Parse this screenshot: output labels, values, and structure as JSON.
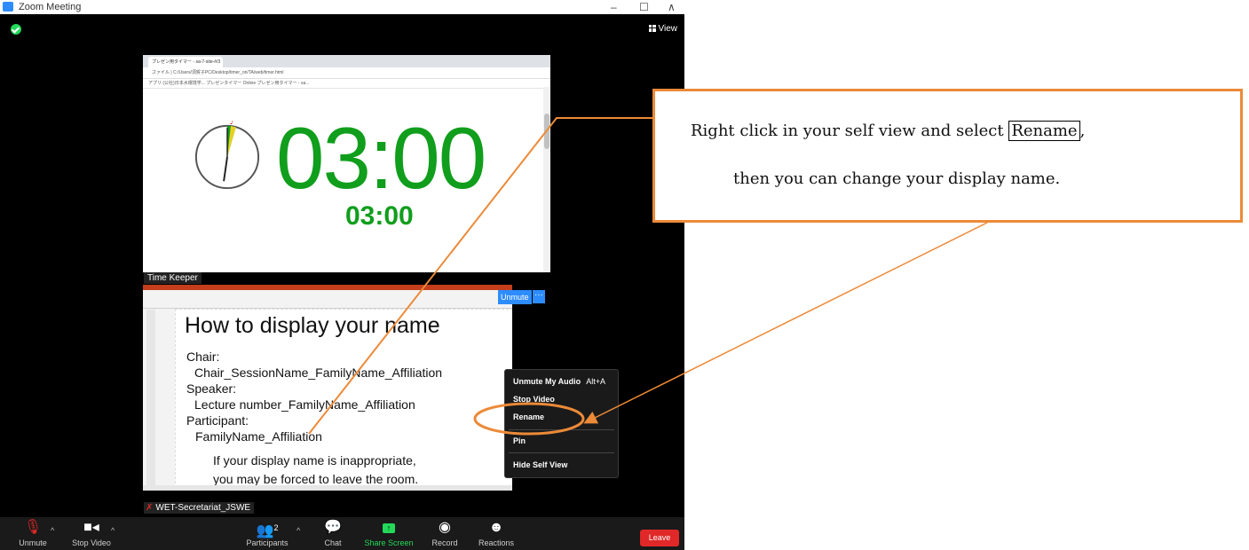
{
  "window": {
    "title": "Zoom Meeting",
    "controls": [
      "–",
      "☐",
      "∧"
    ]
  },
  "view_button": "View",
  "share_screen": {
    "browser_tab": "プレゼン用タイマー - sa-7-site-#/3 ...",
    "browser_address": "ファイル | C:/Users/須賀子PC/Desktop/timer_on/TA/web/timer.html",
    "browser_bookmarks": "アプリ   (公社)日本水環境学...   プレゼンタイマー Online   プレゼン用タイマー - sa...",
    "timer_main": "03:00",
    "timer_sub": "03:00",
    "presenter_label": "Time Keeper"
  },
  "self_view": {
    "slide_title": "How to display your name",
    "slide_lines": [
      "Chair:",
      "Chair_SessionName_FamilyName_Affiliation",
      "Speaker:",
      "Lecture number_FamilyName_Affiliation",
      "Participant:",
      "FamilyName_Affiliation"
    ],
    "slide_note": [
      "If your display name is inappropriate,",
      "you may be forced to leave the room."
    ],
    "unmute_label": "Unmute",
    "more_label": "···",
    "participant_name": "WET-Secretariat_JSWE"
  },
  "context_menu": {
    "items": [
      {
        "label": "Unmute My Audio",
        "shortcut": "Alt+A"
      },
      {
        "label": "Stop Video",
        "shortcut": ""
      },
      {
        "label": "Rename",
        "shortcut": ""
      },
      {
        "label": "Pin",
        "shortcut": ""
      },
      {
        "label": "Hide Self View",
        "shortcut": ""
      }
    ]
  },
  "toolbar": {
    "unmute": "Unmute",
    "stop_video": "Stop Video",
    "participants": "Participants",
    "participants_count": "2",
    "chat": "Chat",
    "share_screen": "Share Screen",
    "record": "Record",
    "reactions": "Reactions",
    "leave": "Leave"
  },
  "callout": {
    "line1_before": "Right click in your self view and select ",
    "line1_boxed": "Rename",
    "line1_after": ",",
    "line2": "then you can change your display name."
  },
  "colors": {
    "zoom_blue": "#2d8cff",
    "timer_green": "#109e1c",
    "leave_red": "#e02828",
    "annotation_orange": "#ec8a38"
  }
}
